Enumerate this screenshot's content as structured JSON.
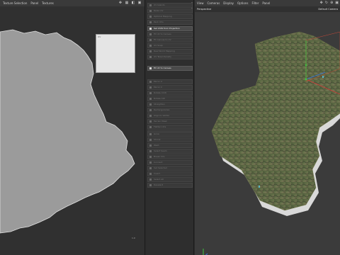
{
  "uv_editor": {
    "menu": [
      "Texture Selection",
      "Panel",
      "Textures"
    ],
    "tool_icons": [
      "move-icon",
      "grid-icon",
      "lock-icon",
      "layout-icon"
    ],
    "thumbnail_label": "UV",
    "coordinate_text": "1.0"
  },
  "tool_panel": {
    "groups": [
      {
        "items": [
          {
            "label": "UV Islands",
            "state": "dim"
          },
          {
            "label": "Relax UV",
            "state": "dim"
          },
          {
            "label": "Optimal Mapping",
            "state": "dim"
          },
          {
            "label": "Pack UVs",
            "state": "dim"
          }
        ]
      },
      {
        "items": [
          {
            "label": "Set UVW from Projection",
            "state": "active"
          },
          {
            "label": "Fit UV to Canvas",
            "state": "dim"
          },
          {
            "label": "Fit Canvas to UV",
            "state": "dim"
          },
          {
            "label": "UV Snap",
            "state": "dim"
          },
          {
            "label": "Real World Mapping",
            "state": "dim"
          },
          {
            "label": "UV Texel Density",
            "state": "dim"
          }
        ]
      },
      {
        "items": [
          {
            "label": "Fit UV to Canvas",
            "state": "active"
          }
        ]
      },
      {
        "items": [
          {
            "label": "Mirror U",
            "state": "dim"
          },
          {
            "label": "Mirror V",
            "state": "dim"
          },
          {
            "label": "Rotate CCW",
            "state": "dim"
          },
          {
            "label": "Rotate CW",
            "state": "dim"
          },
          {
            "label": "Straighten",
            "state": "dim"
          },
          {
            "label": "Rectangularize",
            "state": "dim"
          },
          {
            "label": "Align to Vertex",
            "state": "dim"
          },
          {
            "label": "Terrain Mask",
            "state": "dim"
          },
          {
            "label": "Flatten UVs",
            "state": "dim"
          },
          {
            "label": "Equalize UVs",
            "state": "dim"
          }
        ]
      },
      {
        "items": [
          {
            "label": "Grow",
            "state": "dim"
          },
          {
            "label": "Shrink",
            "state": "dim"
          },
          {
            "label": "Weld",
            "state": "dim"
          },
          {
            "label": "Select Seam",
            "state": "dim"
          },
          {
            "label": "Break UVs",
            "state": "dim"
          },
          {
            "label": "Connect",
            "state": "dim"
          },
          {
            "label": "Set Selected",
            "state": "dim"
          },
          {
            "label": "Invert",
            "state": "dim"
          },
          {
            "label": "Select All",
            "state": "dim"
          },
          {
            "label": "Deselect",
            "state": "dim"
          }
        ]
      }
    ]
  },
  "viewport": {
    "menu": [
      "View",
      "Cameras",
      "Display",
      "Options",
      "Filter",
      "Panel"
    ],
    "view_name": "Perspective",
    "camera_name": "Default Camera",
    "header_icons": [
      "move-icon",
      "rotate-icon",
      "zoom-icon",
      "layout-icon"
    ],
    "colors": {
      "axis_x": "#d63a3a",
      "axis_y": "#3fc43f",
      "axis_z": "#3a73e0"
    }
  }
}
